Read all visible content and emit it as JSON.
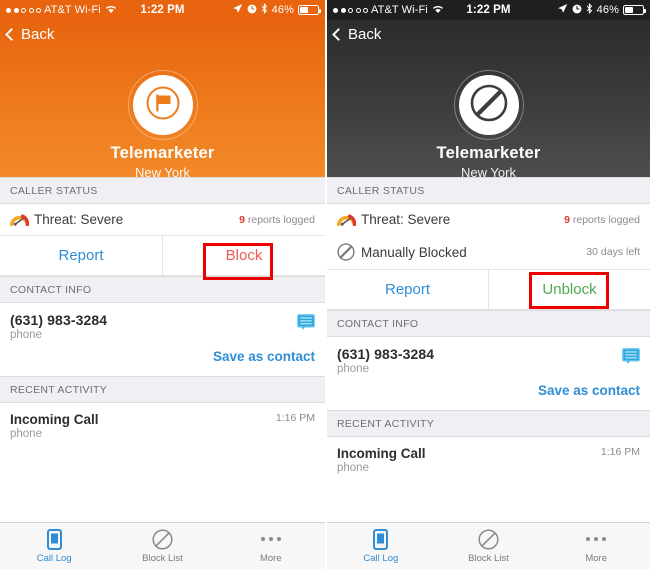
{
  "statusbar": {
    "signal_dots": "●●○○○",
    "carrier": "AT&T Wi-Fi",
    "wifi_icon": "wifi-icon",
    "time": "1:22 PM",
    "location_icon": "location-arrow-icon",
    "alarm_icon": "alarm-clock-icon",
    "bluetooth_icon": "bluetooth-icon",
    "battery_pct": "46%",
    "battery_icon": "battery-icon"
  },
  "nav": {
    "back_label": "Back",
    "back_icon": "chevron-left-icon"
  },
  "panels": [
    {
      "id": "unblocked",
      "theme_color": "#ee7b1c",
      "avatar_icon": "flag-icon",
      "name": "Telemarketer",
      "location": "New York",
      "caller_status": {
        "header": "CALLER STATUS",
        "rows": [
          {
            "icon": "speedometer-threat-icon",
            "label": "Threat: Severe",
            "meta_count": "9",
            "meta_text": " reports logged"
          }
        ],
        "actions": [
          {
            "label": "Report",
            "style": "blue",
            "highlighted": false
          },
          {
            "label": "Block",
            "style": "red",
            "highlighted": true
          }
        ]
      },
      "contact_info": {
        "header": "CONTACT INFO",
        "number": "(631) 983-3284",
        "number_kind": "phone",
        "message_icon": "message-bubble-icon",
        "save_label": "Save as contact"
      },
      "recent_activity": {
        "header": "RECENT ACTIVITY",
        "items": [
          {
            "title": "Incoming Call",
            "kind": "phone",
            "time": "1:16 PM"
          }
        ]
      }
    },
    {
      "id": "blocked",
      "theme_color": "#3d3d3d",
      "avatar_icon": "block-slash-icon",
      "name": "Telemarketer",
      "location": "New York",
      "caller_status": {
        "header": "CALLER STATUS",
        "rows": [
          {
            "icon": "speedometer-threat-icon",
            "label": "Threat: Severe",
            "meta_count": "9",
            "meta_text": " reports logged"
          },
          {
            "icon": "block-slash-icon",
            "label": "Manually Blocked",
            "meta_count": "",
            "meta_text": "30 days left"
          }
        ],
        "actions": [
          {
            "label": "Report",
            "style": "blue",
            "highlighted": false
          },
          {
            "label": "Unblock",
            "style": "green",
            "highlighted": true
          }
        ]
      },
      "contact_info": {
        "header": "CONTACT INFO",
        "number": "(631) 983-3284",
        "number_kind": "phone",
        "message_icon": "message-bubble-icon",
        "save_label": "Save as contact"
      },
      "recent_activity": {
        "header": "RECENT ACTIVITY",
        "items": [
          {
            "title": "Incoming Call",
            "kind": "phone",
            "time": "1:16 PM"
          }
        ]
      }
    }
  ],
  "tabbar": {
    "tabs": [
      {
        "icon": "phone-device-icon",
        "label": "Call Log",
        "active": true
      },
      {
        "icon": "block-slash-icon",
        "label": "Block List",
        "active": false
      },
      {
        "icon": "ellipsis-icon",
        "label": "More",
        "active": false
      }
    ]
  },
  "colors": {
    "accent_blue": "#2f8ed6",
    "block_red": "#ee5b55",
    "unblock_green": "#4ea84e",
    "annotation_red": "#ee0000",
    "orange_header": "#ee7b1c",
    "dark_header": "#3d3d3d"
  }
}
